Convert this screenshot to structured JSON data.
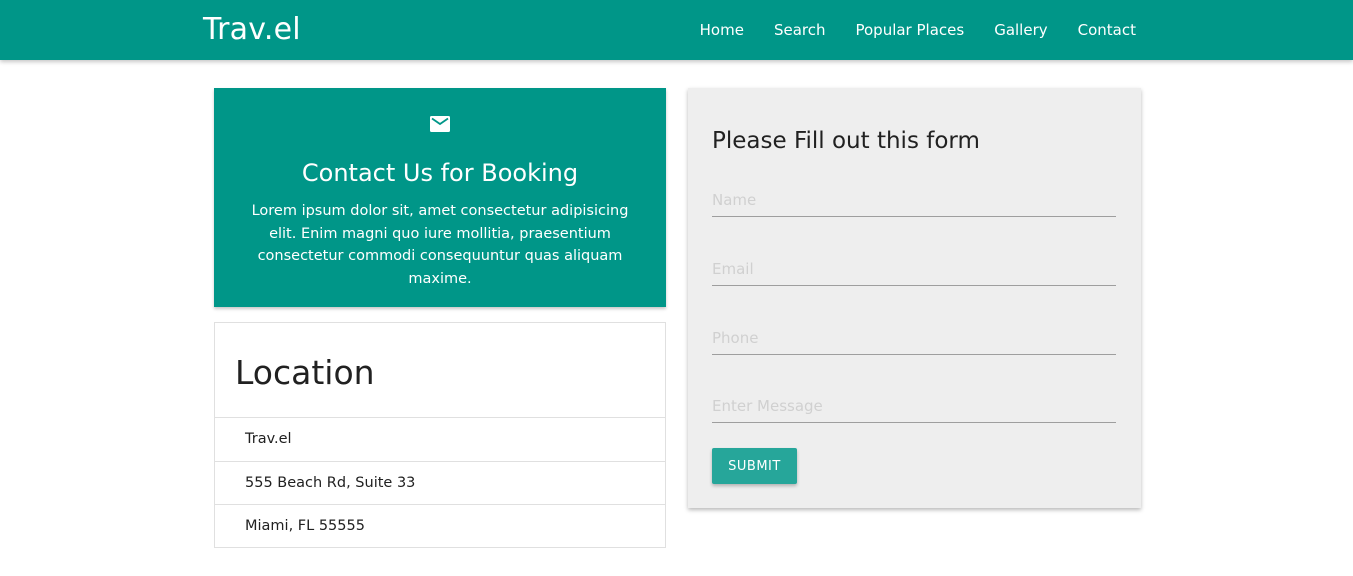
{
  "navbar": {
    "brand": "Trav.el",
    "links": [
      {
        "label": "Home"
      },
      {
        "label": "Search"
      },
      {
        "label": "Popular Places"
      },
      {
        "label": "Gallery"
      },
      {
        "label": "Contact"
      }
    ],
    "color": "#009688"
  },
  "contact_card": {
    "icon": "email-icon",
    "title": "Contact Us for Booking",
    "text": "Lorem ipsum dolor sit, amet consectetur adipisicing elit. Enim magni quo iure mollitia, praesentium consectetur commodi consequuntur quas aliquam maxime."
  },
  "location": {
    "title": "Location",
    "items": [
      "Trav.el",
      "555 Beach Rd, Suite 33",
      "Miami, FL 55555"
    ]
  },
  "form": {
    "title": "Please Fill out this form",
    "name_placeholder": "Name",
    "email_placeholder": "Email",
    "phone_placeholder": "Phone",
    "message_placeholder": "Enter Message",
    "submit_label": "SUBMIT",
    "button_color": "#26a69a"
  }
}
